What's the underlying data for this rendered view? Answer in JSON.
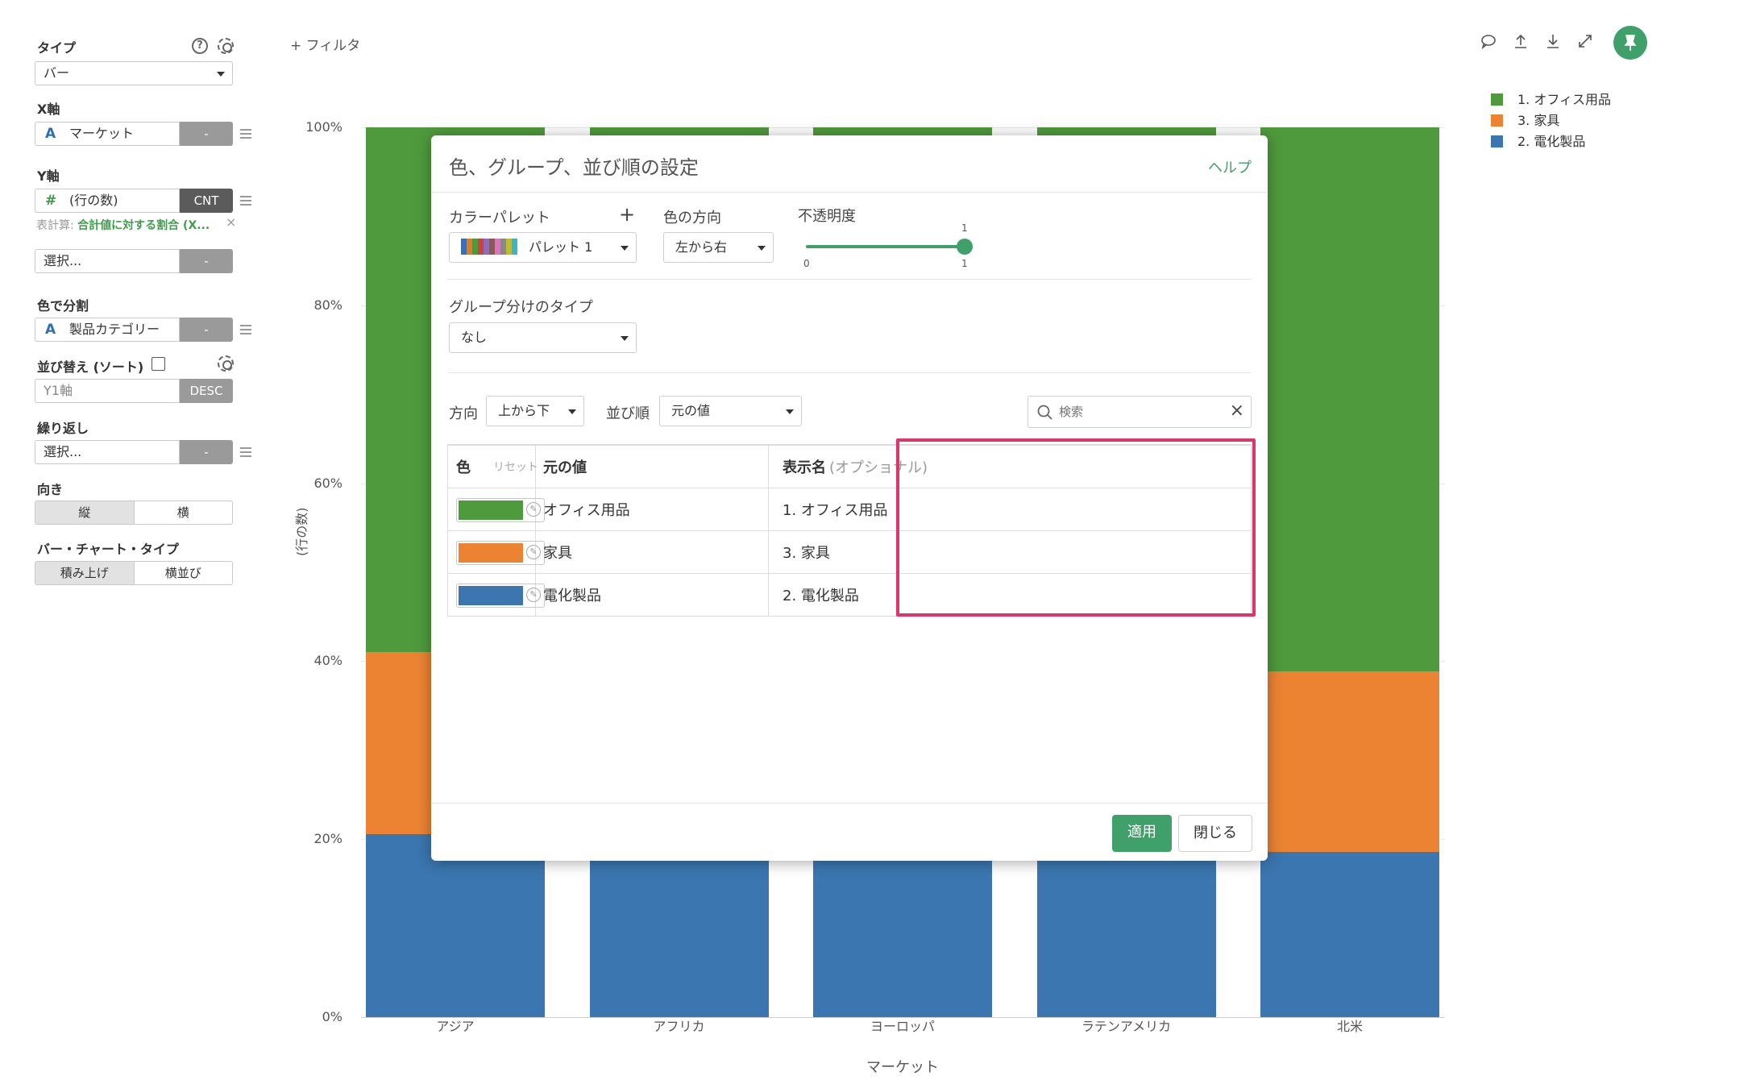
{
  "panel": {
    "type_label": "タイプ",
    "type_value": "バー",
    "x_label": "X軸",
    "x_field": "マーケット",
    "x_agg": "-",
    "y_label": "Y軸",
    "y_field": "(行の数)",
    "y_agg": "CNT",
    "table_calc_prefix": "表計算:",
    "table_calc_value": "合計値に対する割合 (X...",
    "extra_select": "選択...",
    "extra_agg": "-",
    "color_label": "色で分割",
    "color_field": "製品カテゴリー",
    "color_agg": "-",
    "sort_label": "並び替え (ソート)",
    "sort_field": "Y1軸",
    "sort_order": "DESC",
    "repeat_label": "繰り返し",
    "repeat_select": "選択...",
    "repeat_agg": "-",
    "orientation_label": "向き",
    "orientation_options": [
      "縦",
      "横"
    ],
    "bar_type_label": "バー・チャート・タイプ",
    "bar_type_options": [
      "積み上げ",
      "横並び"
    ]
  },
  "filter_label": "+ フィルタ",
  "chart_data": {
    "type": "bar",
    "stacked": true,
    "categories": [
      "アジア",
      "アフリカ",
      "ヨーロッパ",
      "ラテンアメリカ",
      "北米"
    ],
    "series": [
      {
        "name": "2. 電化製品",
        "color": "#3b76b0",
        "values": [
          20.6,
          20.6,
          20.6,
          20.6,
          18.6
        ]
      },
      {
        "name": "3. 家具",
        "color": "#ec8333",
        "values": [
          20.4,
          20.4,
          20.4,
          20.4,
          20.3
        ]
      },
      {
        "name": "1. オフィス用品",
        "color": "#4f9a3c",
        "values": [
          59.0,
          59.0,
          59.0,
          59.0,
          61.1
        ]
      }
    ],
    "yticks": [
      "100%",
      "80%",
      "60%",
      "40%",
      "20%",
      "0%"
    ],
    "ylabel": "(行の数)",
    "xlabel": "マーケット",
    "ylim": [
      0,
      100
    ]
  },
  "legend": [
    {
      "label": "1. オフィス用品",
      "color": "#4f9a3c"
    },
    {
      "label": "3. 家具",
      "color": "#ec8333"
    },
    {
      "label": "2. 電化製品",
      "color": "#3b76b0"
    }
  ],
  "modal": {
    "title": "色、グループ、並び順の設定",
    "help": "ヘルプ",
    "palette_label": "カラーパレット",
    "palette_add": "+",
    "palette_value": "パレット 1",
    "direction_label": "色の方向",
    "direction_value": "左から右",
    "opacity_label": "不透明度",
    "opacity_value": "1",
    "opacity_min": "0",
    "opacity_max": "1",
    "group_label": "グループ分けのタイプ",
    "group_value": "なし",
    "order_dir_label": "方向",
    "order_dir_value": "上から下",
    "order_label": "並び順",
    "order_value": "元の値",
    "search_placeholder": "検索",
    "col_color": "色",
    "col_reset": "リセット",
    "col_original": "元の値",
    "col_display": "表示名",
    "col_display_optional": "(オプショナル)",
    "rows": [
      {
        "color": "#4f9a3c",
        "original": "オフィス用品",
        "display": "1. オフィス用品"
      },
      {
        "color": "#ec8333",
        "original": "家具",
        "display": "3. 家具"
      },
      {
        "color": "#3b76b0",
        "original": "電化製品",
        "display": "2. 電化製品"
      }
    ],
    "apply": "適用",
    "close": "閉じる"
  }
}
